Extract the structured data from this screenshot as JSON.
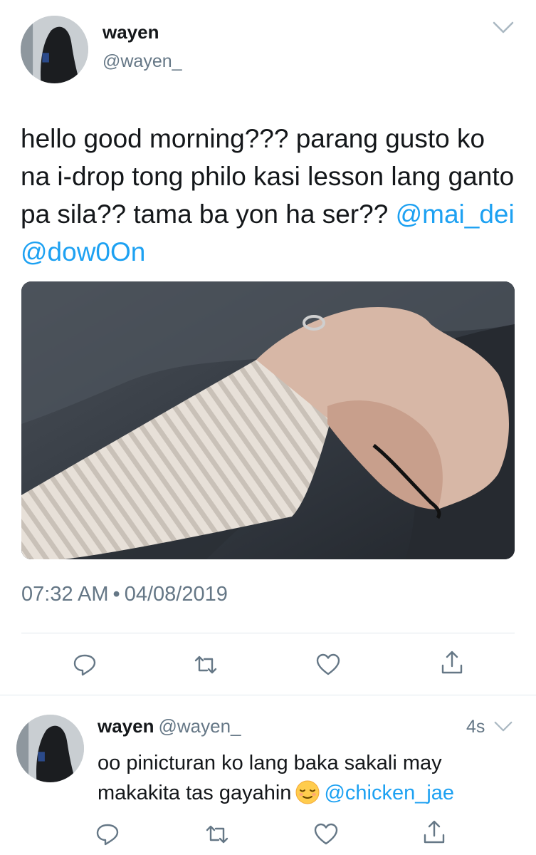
{
  "tweet": {
    "display_name": "wayen",
    "handle": "@wayen_",
    "text": "hello good morning??? parang gusto ko na i-drop tong philo kasi lesson lang ganto pa sila?? tama ba yon ha ser??",
    "mentions": [
      "@mai_dei",
      "@dow0On"
    ],
    "time": "07:32 AM",
    "separator": "•",
    "date": "04/08/2019",
    "actions": [
      "reply-icon",
      "retweet-icon",
      "like-icon",
      "share-icon"
    ]
  },
  "reply": {
    "display_name": "wayen",
    "handle": "@wayen_",
    "age": "4s",
    "text": "oo pinicturan ko lang baka sakali may makakita tas gayahin",
    "emoji": "relieved-face-emoji",
    "mention": "@chicken_jae",
    "actions": [
      "reply-icon",
      "retweet-icon",
      "like-icon",
      "share-icon"
    ]
  },
  "colors": {
    "link": "#1da1f2",
    "secondary_text": "#657786",
    "primary_text": "#14171a",
    "divider": "#e1e8ed"
  }
}
